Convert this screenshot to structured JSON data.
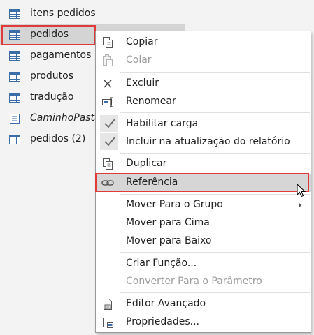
{
  "queries": [
    {
      "label": "itens pedidos",
      "icon": "table-icon"
    },
    {
      "label": "pedidos",
      "icon": "table-icon",
      "selected": true
    },
    {
      "label": "pagamentos",
      "icon": "table-icon"
    },
    {
      "label": "produtos",
      "icon": "table-icon"
    },
    {
      "label": "tradução",
      "icon": "table-icon"
    },
    {
      "label": "CaminhoPasta",
      "icon": "parameter-icon"
    },
    {
      "label": "pedidos (2)",
      "icon": "table-icon"
    }
  ],
  "context_menu": {
    "items": [
      {
        "label": "Copiar",
        "icon": "copy-icon",
        "enabled": true
      },
      {
        "label": "Colar",
        "icon": "paste-icon",
        "enabled": false
      },
      {
        "label": "Excluir",
        "icon": "delete-icon",
        "enabled": true
      },
      {
        "label": "Renomear",
        "icon": "rename-icon",
        "enabled": true
      },
      {
        "label": "Habilitar carga",
        "icon": "checkmark-icon",
        "enabled": true,
        "checked": true
      },
      {
        "label": "Incluir na atualização do relatório",
        "icon": "checkmark-icon",
        "enabled": true,
        "checked": true
      },
      {
        "label": "Duplicar",
        "icon": "duplicate-icon",
        "enabled": true
      },
      {
        "label": "Referência",
        "icon": "reference-link-icon",
        "enabled": true,
        "hovered": true
      },
      {
        "label": "Mover Para o Grupo",
        "icon": "",
        "enabled": true,
        "submenu": true
      },
      {
        "label": "Mover para Cima",
        "icon": "",
        "enabled": true
      },
      {
        "label": "Mover para Baixo",
        "icon": "",
        "enabled": true
      },
      {
        "label": "Criar Função...",
        "icon": "",
        "enabled": true
      },
      {
        "label": "Converter Para o Parâmetro",
        "icon": "",
        "enabled": false
      },
      {
        "label": "Editor Avançado",
        "icon": "advanced-editor-icon",
        "enabled": true
      },
      {
        "label": "Propriedades...",
        "icon": "properties-icon",
        "enabled": true
      }
    ]
  },
  "colors": {
    "highlight_border": "#e03b3b",
    "selected_bg": "#d4d4d4",
    "hover_bg": "#d6d6d6",
    "disabled_text": "#9d9d9d"
  }
}
